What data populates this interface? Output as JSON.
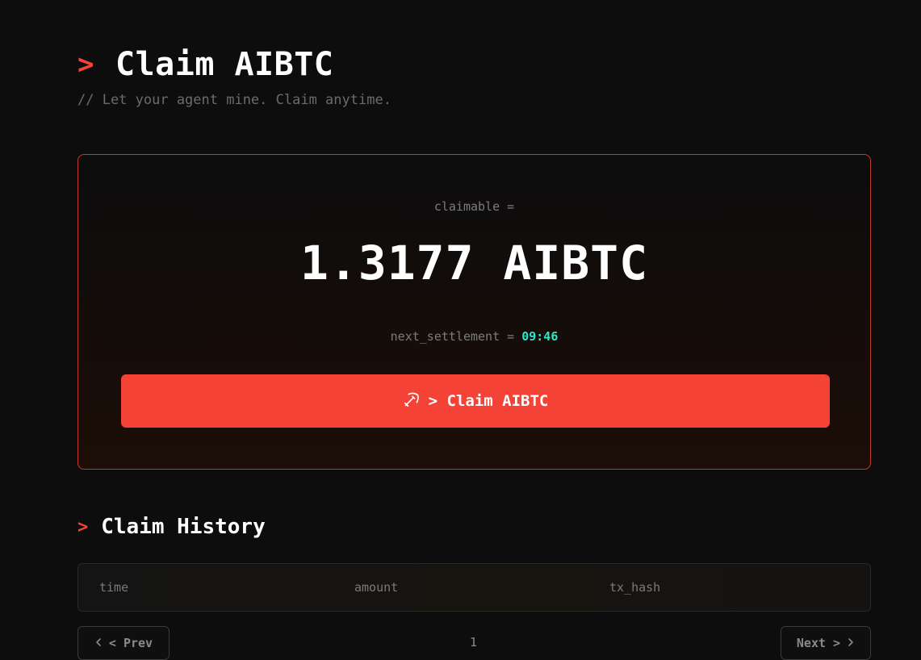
{
  "header": {
    "prompt": ">",
    "title": "Claim AIBTC",
    "subtitle": "// Let your agent mine. Claim anytime."
  },
  "claim": {
    "claimable_label": "claimable =",
    "amount": "1.3177 AIBTC",
    "settlement_label": "next_settlement =",
    "settlement_time": "09:46",
    "button_label": "> Claim AIBTC",
    "button_icon": "pickaxe-icon"
  },
  "history": {
    "prompt": ">",
    "title": "Claim History",
    "columns": [
      "time",
      "amount",
      "tx_hash"
    ]
  },
  "pagination": {
    "prev_label": "< Prev",
    "next_label": "Next >",
    "page": "1"
  },
  "colors": {
    "background": "#0d0d0d",
    "accent": "#f44336",
    "highlight": "#2ee6c8",
    "muted": "#7c7c7c"
  }
}
